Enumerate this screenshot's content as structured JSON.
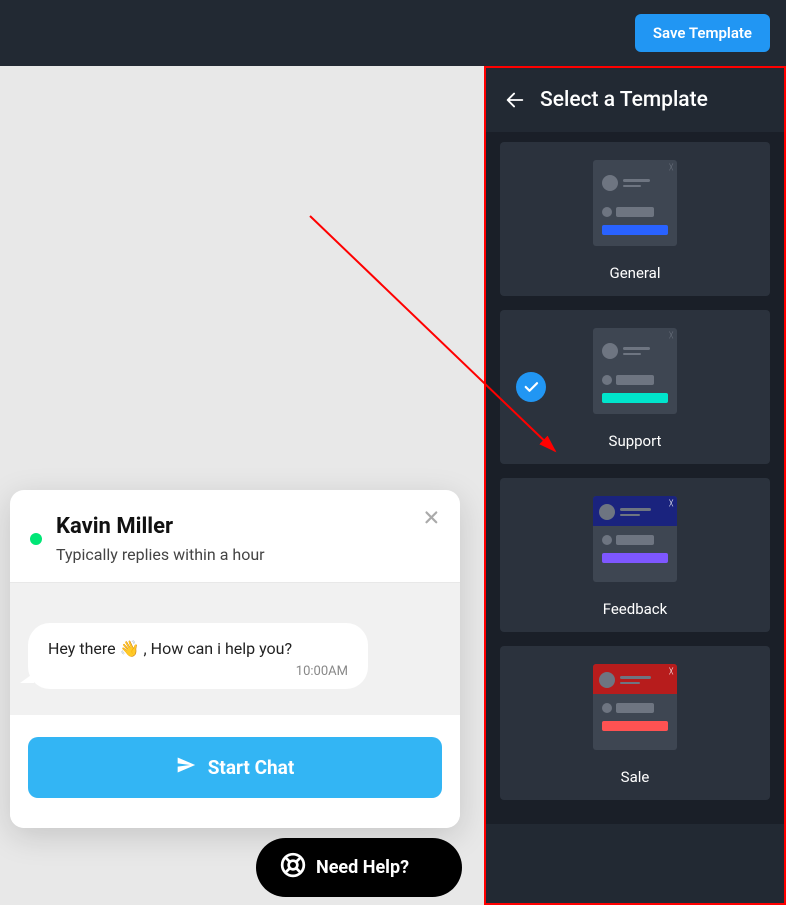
{
  "topbar": {
    "save_label": "Save Template"
  },
  "sidebar": {
    "title": "Select a Template",
    "templates": [
      {
        "name": "General",
        "accent": "#2962ff",
        "header_bg": "transparent"
      },
      {
        "name": "Support",
        "accent": "#00e5cc",
        "header_bg": "transparent",
        "selected": true
      },
      {
        "name": "Feedback",
        "accent": "#7e57ff",
        "header_bg": "#1a237e"
      },
      {
        "name": "Sale",
        "accent": "#ff5252",
        "header_bg": "#b71c1c"
      }
    ]
  },
  "chat": {
    "name": "Kavin Miller",
    "subtitle": "Typically replies within a hour",
    "message_prefix": "Hey there",
    "message_suffix": ", How can i help you?",
    "wave_emoji": "👋",
    "timestamp": "10:00AM",
    "start_label": "Start Chat"
  },
  "help": {
    "label": "Need Help?"
  }
}
